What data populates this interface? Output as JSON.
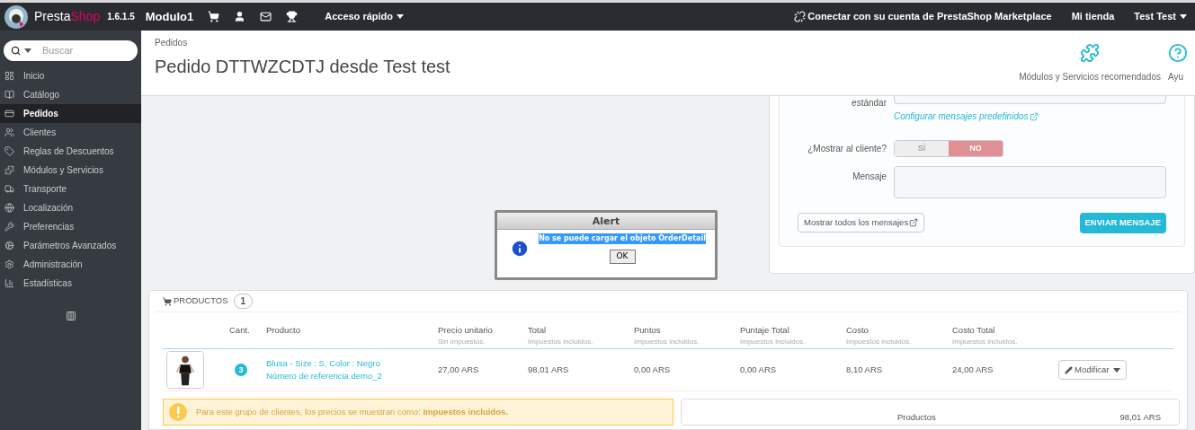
{
  "topbar": {
    "brand_a": "Presta",
    "brand_b": "Shop",
    "version": "1.6.1.5",
    "shop": "Modulo1",
    "quick_access": "Acceso rápido",
    "connect": "Conectar con su cuenta de PrestaShop Marketplace",
    "my_shop": "Mi tienda",
    "user": "Test Test"
  },
  "sidebar": {
    "search": {
      "placeholder": "Buscar"
    },
    "items": [
      {
        "label": "Inicio",
        "selected": false
      },
      {
        "label": "Catálogo",
        "selected": false
      },
      {
        "label": "Pedidos",
        "selected": true
      },
      {
        "label": "Clientes",
        "selected": false
      },
      {
        "label": "Reglas de Descuentos",
        "selected": false
      },
      {
        "label": "Módulos y Servicios",
        "selected": false
      },
      {
        "label": "Transporte",
        "selected": false
      },
      {
        "label": "Localización",
        "selected": false
      },
      {
        "label": "Preferencias",
        "selected": false
      },
      {
        "label": "Parámetros Avanzados",
        "selected": false
      },
      {
        "label": "Administración",
        "selected": false
      },
      {
        "label": "Estadísticas",
        "selected": false
      }
    ]
  },
  "header": {
    "breadcrumb": "Pedidos",
    "title": "Pedido DTTWZCDTJ desde Test test",
    "toolbar": [
      {
        "label": "Módulos y Servicios recomendados"
      },
      {
        "label": "Ayu"
      }
    ]
  },
  "message_panel": {
    "standard_label": "estándar",
    "configure_link": "Configurar mensajes predefinidos",
    "show_label": "¿Mostrar al cliente?",
    "show_options": [
      {
        "label": "SÍ",
        "selected": false
      },
      {
        "label": "NO",
        "selected": true
      }
    ],
    "message_label": "Mensaje",
    "show_all": "Mostrar todos los mensajes",
    "send": "ENVIAR MENSAJE"
  },
  "alert": {
    "title": "Alert",
    "message": "No se puede cargar el objeto OrderDetail",
    "ok": "OK"
  },
  "products": {
    "title": "PRODUCTOS",
    "count": "1",
    "columns": [
      {
        "label": "Cant."
      },
      {
        "label": "Producto"
      },
      {
        "label": "Precio unitario",
        "sub": "Sin impuestos."
      },
      {
        "label": "Total",
        "sub": "Impuestos incluidos."
      },
      {
        "label": "Puntos",
        "sub": "Impuestos incluidos."
      },
      {
        "label": "Puntaje Total",
        "sub": "Impuestos incluidos."
      },
      {
        "label": "Costo",
        "sub": "Impuestos incluidos."
      },
      {
        "label": "Costo Total",
        "sub": "Impuestos incluidos."
      }
    ],
    "rows": [
      {
        "qty": "3",
        "name": "Blusa - Size : S, Color : Negro",
        "reference": "Número de referencia demo_2",
        "unit_price": "27,00 ARS",
        "total": "98,01 ARS",
        "points": "0,00 ARS",
        "points_total": "0,00 ARS",
        "cost": "8,10 ARS",
        "cost_total": "24,00 ARS",
        "action": "Modificar"
      }
    ],
    "notice": "Para este grupo de clientes, los precios se muestran como: **Impuestos incluidos.**",
    "summary": {
      "label": "Productos",
      "value": "98,01 ARS"
    }
  }
}
